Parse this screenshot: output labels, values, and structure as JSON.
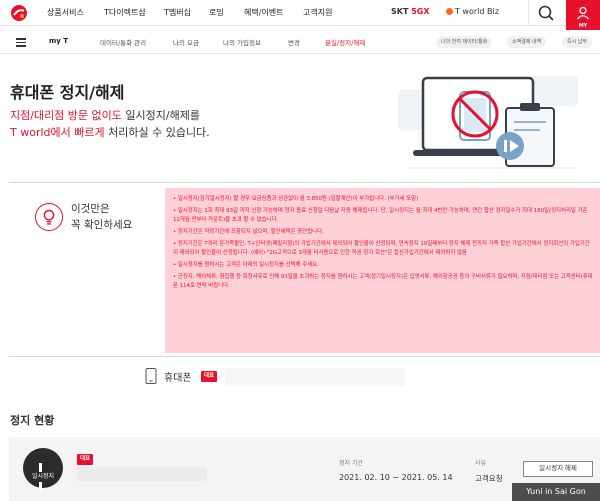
{
  "topnav": {
    "menus": [
      "상품서비스",
      "T다이렉트샵",
      "T멤버십",
      "로밍",
      "혜택/이벤트",
      "고객지원"
    ],
    "skt_prefix": "SKT",
    "skt_brand": "5GX",
    "tworld_biz": "T world Biz",
    "my_label": "MY"
  },
  "subnav": {
    "myt": "my T",
    "items": [
      "데이터/통화 관리",
      "나의 요금",
      "나의 가입정보",
      "변경",
      "분실/정지/해제"
    ],
    "chips": [
      "나의 잔여 데이터/통화",
      "소액결제 내역",
      "즉시 납부"
    ]
  },
  "hero": {
    "title": "휴대폰 정지/해제",
    "line1_red": "지점/대리점 방문 없이도",
    "line1_rest": " 일시정지/해제를",
    "line2_red": "T world에서 빠르게",
    "line2_rest": " 처리하실 수 있습니다."
  },
  "notice": {
    "title_line1": "이것만은",
    "title_line2": "꼭 확인하세요",
    "p1": "• 일시정지(장기일시정지) 할 경우 요금상품과 상관없이 월 3,850원 (일할계산)이 부가됩니다. (부가세 포함)",
    "p2": "• 일시정지는 1회 최대 93일 까지 신청 가능하며 정지 종료 신청일 다음날 자동 해제됩니다. 단, 일시정지는 월 최대 4번만 가능하며, 연간 합산 정지일수가 최대 180일(정지처리일 기준 12개월 전부터 카운트)을 초과 할 수 없습니다.",
    "p3": "• 정지기간은 약정기간에 포함되지 않으며, 할인혜택은 중단됩니다.",
    "p4": "• 정지기간은 T끼리 온가족할인, T+인터넷(패밀리형)의 가입기간에서 제외되어 할인율이 산정되며, 연속정지 10일째부터 정지 해제 전까지 가족 합산 가입기간에서 정지회선의 가입기간이 제외되어 할인율이 산정됩니다. (예외) \"2G고객으로 3개월 미사용으로 인한 직권 정지 회선\"은 합산가입기간에서 제외하지 않음",
    "p5": "• 일시정지를 원하시는 고객은 아래의 일시정지를 선택해 주세요.",
    "p6": "• 군정지, 해외체류, 형집행 등 특정사유로 인해 93일을 초과하는 정지를 원하시는 고객(장기일시정지)은 입영서류, 해외항공권 등의 구비서류가 필요하며, 지점/대리점 또는 고객센터(휴대폰 114로 연락 바랍니다."
  },
  "phone": {
    "label": "휴대폰",
    "tag": "대표"
  },
  "status": {
    "title": "정지 현황",
    "pause_label": "일시정지",
    "tag": "대표",
    "period_label": "정지 기간",
    "period_value": "2021. 02. 10 ~ 2021. 05. 14",
    "reason_label": "사유",
    "reason_value": "고객요청",
    "cancel_button": "일시정지 해제"
  },
  "watermark": "Yuni in Sai Gon",
  "colors": {
    "accent": "#e8112d",
    "notice_bg": "#ffd0d5"
  }
}
